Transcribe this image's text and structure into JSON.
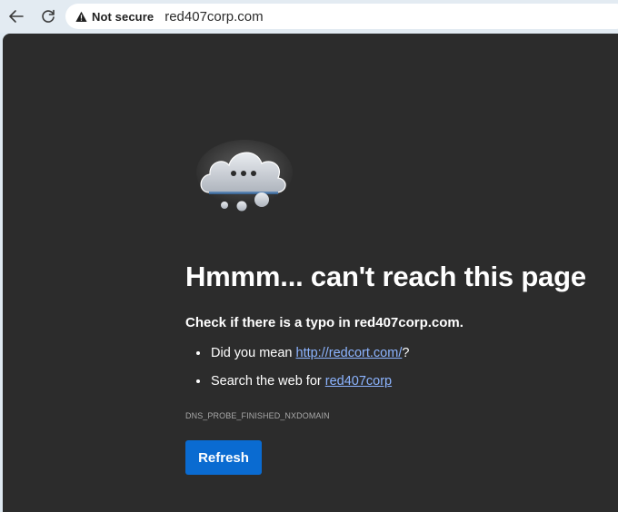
{
  "toolbar": {
    "back_icon": "arrow-left-icon",
    "refresh_icon": "refresh-icon",
    "security_icon": "warning-triangle-icon",
    "security_label": "Not secure",
    "url": "red407corp.com"
  },
  "error_page": {
    "illustration_icon": "cloud-thinking-icon",
    "heading": "Hmmm... can't reach this page",
    "subheading": "Check if there is a typo in red407corp.com.",
    "suggestions": [
      {
        "prefix": "Did you mean ",
        "link": "http://redcort.com/",
        "suffix": "?"
      },
      {
        "prefix": "Search the web for ",
        "link": "red407corp",
        "suffix": ""
      }
    ],
    "error_code": "DNS_PROBE_FINISHED_NXDOMAIN",
    "refresh_button": "Refresh"
  },
  "colors": {
    "page_background": "#2c2c2c",
    "toolbar_background": "#e3ebf2",
    "link": "#8cb4ff",
    "button": "#0a6bd1"
  }
}
